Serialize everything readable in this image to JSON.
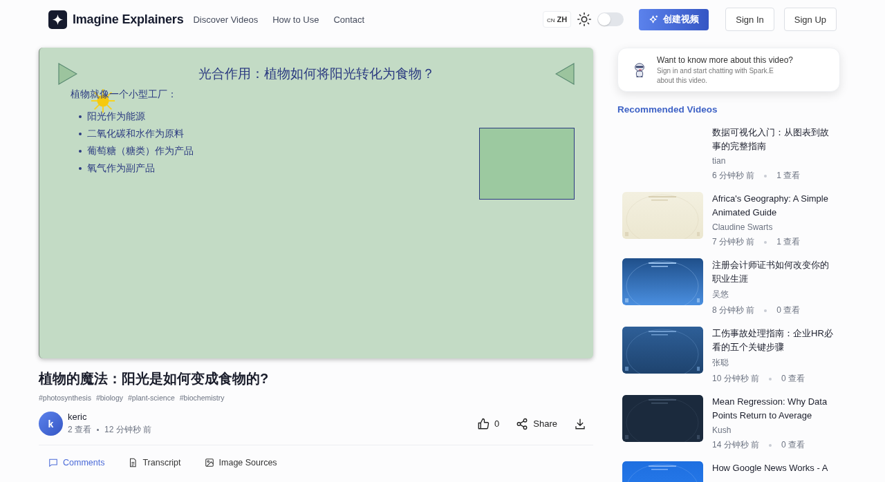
{
  "header": {
    "brand": "Imagine Explainers",
    "nav": [
      {
        "label": "Discover Videos"
      },
      {
        "label": "How to Use"
      },
      {
        "label": "Contact"
      }
    ],
    "language": {
      "region": "CN",
      "code": "ZH"
    },
    "dark_mode": {
      "on": false
    },
    "create_button": "创建视频",
    "sign_in": "Sign In",
    "sign_up": "Sign Up"
  },
  "slide": {
    "title": "光合作用：植物如何将阳光转化为食物？",
    "intro": "植物就像一个小型工厂：",
    "bullets": [
      "阳光作为能源",
      "二氧化碳和水作为原料",
      "葡萄糖（糖类）作为产品",
      "氧气作为副产品"
    ]
  },
  "video": {
    "title": "植物的魔法：阳光是如何变成食物的?",
    "tags": [
      "#photosynthesis",
      "#biology",
      "#plant-science",
      "#biochemistry"
    ],
    "author": {
      "initial": "k",
      "name": "keric",
      "views": "2 查看",
      "time": "12 分钟秒 前"
    },
    "likes": "0",
    "share": "Share"
  },
  "tabs": [
    {
      "label": "Comments",
      "selected": true
    },
    {
      "label": "Transcript",
      "selected": false
    },
    {
      "label": "Image Sources",
      "selected": false
    }
  ],
  "chat_prompt": {
    "title": "Want to know more about this video?",
    "text": "Sign in and start chatting with Spark.E about this video."
  },
  "recommended": {
    "heading": "Recommended Videos",
    "items": [
      {
        "title": "数据可视化入门：从图表到故事的完整指南",
        "author": "tian",
        "time": "6 分钟秒 前",
        "views": "1 查看"
      },
      {
        "kind": "picture",
        "title": "Africa's Geography: A Simple Animated Guide",
        "author": "Claudine Swarts",
        "time": "7 分钟秒 前",
        "views": "1 查看"
      },
      {
        "kind": "picture",
        "title": "注册会计师证书如何改变你的职业生涯",
        "author": "吴悠",
        "time": "8 分钟秒 前",
        "views": "0 查看"
      },
      {
        "kind": "picture",
        "title": "工伤事故处理指南：企业HR必看的五个关键步骤",
        "author": "张聪",
        "time": "10 分钟秒 前",
        "views": "0 查看"
      },
      {
        "kind": "picture",
        "title": "Mean Regression: Why Data Points Return to Average",
        "author": "Kush",
        "time": "14 分钟秒 前",
        "views": "0 查看"
      },
      {
        "kind": "picture",
        "title": "How Google News Works - A"
      }
    ]
  }
}
